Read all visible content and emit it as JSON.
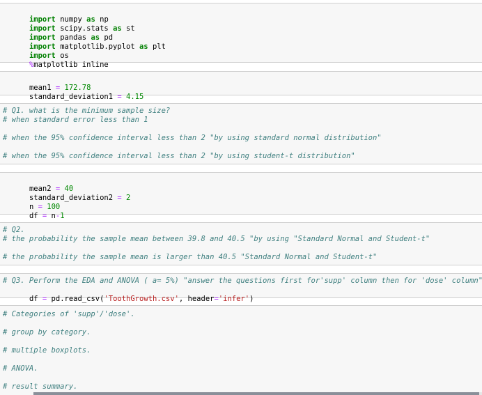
{
  "cells": {
    "c1": {
      "l1": {
        "kw": "import",
        "mod": " numpy ",
        "as": "as",
        "alias": " np"
      },
      "l2": {
        "kw": "import",
        "mod": " scipy.stats ",
        "as": "as",
        "alias": " st"
      },
      "l3": {
        "kw": "import",
        "mod": " pandas ",
        "as": "as",
        "alias": " pd"
      },
      "l4": {
        "kw": "import",
        "mod": " matplotlib.pyplot ",
        "as": "as",
        "alias": " plt"
      },
      "l5": {
        "kw": "import",
        "mod": " os"
      },
      "l6": {
        "magic": "%",
        "rest": "matplotlib inline"
      }
    },
    "c2": {
      "l1": {
        "name": "mean1 ",
        "op": "=",
        "val": " 172.78"
      },
      "l2": {
        "name": "standard_deviation1 ",
        "op": "=",
        "val": " 4.15"
      }
    },
    "c3": {
      "l1": "# Q1. what is the minimum sample size?",
      "l2": "# when standard error less than 1",
      "l3": "# when the 95% confidence interval less than 2 \"by using standard normal distribution\"",
      "l4": "# when the 95% confidence interval less than 2 \"by using student-t distribution\""
    },
    "c4": {
      "l1": {
        "name": "mean2 ",
        "op": "=",
        "val": " 40"
      },
      "l2": {
        "name": "standard_deviation2 ",
        "op": "=",
        "val": " 2"
      },
      "l3": {
        "name": "n ",
        "op": "=",
        "val": " 100"
      },
      "l4": {
        "name": "df ",
        "op": "=",
        "rest1": " n",
        "op2": "-",
        "val": "1"
      }
    },
    "c5": {
      "l1": "# Q2.",
      "l2": "# the probability the sample mean between 39.8 and 40.5 \"by using \"Standard Normal and Student-t\"",
      "l3": "# the probability the sample mean is larger than 40.5 \"Standard Normal and Student-t\""
    },
    "c6": {
      "l1": "# Q3. Perform the EDA and ANOVA ( a= 5%) \"answer the questions first for'supp' column then for 'dose' column\"",
      "l2": {
        "name": "df ",
        "op": "=",
        "call": " pd.read_csv(",
        "str1": "'ToothGrowth.csv'",
        "mid": ", header",
        "op2": "=",
        "str2": "'infer'",
        "end": ")"
      }
    },
    "c7": {
      "l1": "# Categories of 'supp'/'dose'.",
      "l2": "# group by category.",
      "l3": "# multiple boxplots.",
      "l4": "# ANOVA.",
      "l5": "# result summary."
    }
  },
  "colors": {
    "keyword": "#008000",
    "magic": "#aa22ff",
    "number": "#008800",
    "string": "#ba2121",
    "comment": "#408080",
    "cell_bg": "#f7f7f7",
    "cell_border": "#cfcfcf"
  }
}
